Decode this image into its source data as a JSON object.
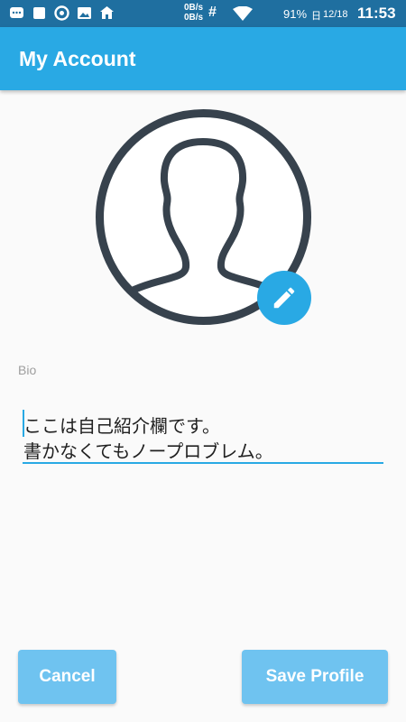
{
  "status_bar": {
    "net_up": "0B/s",
    "net_down": "0B/s",
    "hash": "#",
    "battery_pct": "91%",
    "day": "日",
    "date": "12/18",
    "time": "11:53"
  },
  "app_bar": {
    "title": "My Account"
  },
  "profile": {
    "avatar_icon": "person-silhouette-icon",
    "edit_icon": "pencil-icon"
  },
  "bio": {
    "label": "Bio",
    "line1": "ここは自己紹介欄です。",
    "line2": "書かなくてもノープロブレム。"
  },
  "actions": {
    "cancel_label": "Cancel",
    "save_label": "Save Profile"
  },
  "colors": {
    "status_bar": "#1f6fa0",
    "accent": "#29a9e4",
    "button": "#6fc3f0",
    "avatar_stroke": "#37424d"
  }
}
